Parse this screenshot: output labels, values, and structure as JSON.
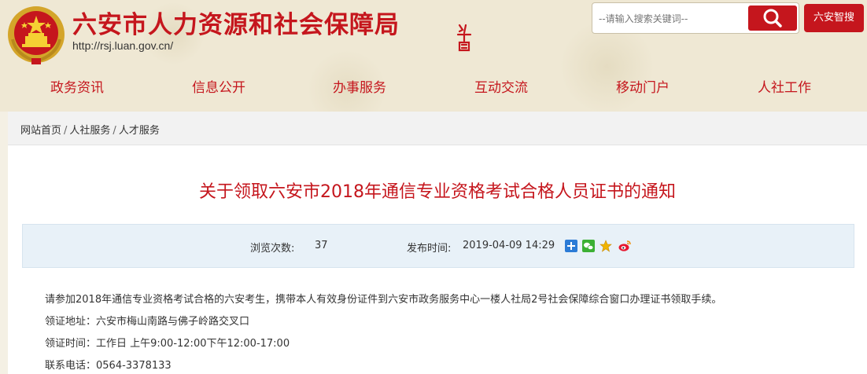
{
  "header": {
    "site_title": "六安市人力资源和社会保障局",
    "site_url": "http://rsj.luan.gov.cn/",
    "search_placeholder": "--请输入搜索关键词--",
    "smart_search_label": "六安智搜"
  },
  "nav": [
    {
      "label": "政务资讯"
    },
    {
      "label": "信息公开"
    },
    {
      "label": "办事服务"
    },
    {
      "label": "互动交流"
    },
    {
      "label": "移动门户"
    },
    {
      "label": "人社工作"
    }
  ],
  "breadcrumb": {
    "home": "网站首页",
    "level1": "人社服务",
    "level2": "人才服务",
    "separator": "/"
  },
  "article": {
    "title": "关于领取六安市2018年通信专业资格考试合格人员证书的通知",
    "views_label": "浏览次数:",
    "views_value": "37",
    "publish_label": "发布时间:",
    "publish_value": "2019-04-09 14:29",
    "paragraphs": [
      "请参加2018年通信专业资格考试合格的六安考生，携带本人有效身份证件到六安市政务服务中心一楼人社局2号社会保障综合窗口办理证书领取手续。",
      "领证地址：六安市梅山南路与佛子岭路交叉口",
      "领证时间：工作日 上午9:00-12:00下午12:00-17:00",
      "联系电话：0564-3378133"
    ]
  },
  "colors": {
    "brand_red": "#c5161d",
    "meta_bg": "#e8f1f8"
  },
  "share_icons": [
    "qzone-icon",
    "wechat-icon",
    "favorite-star-icon",
    "weibo-icon"
  ]
}
